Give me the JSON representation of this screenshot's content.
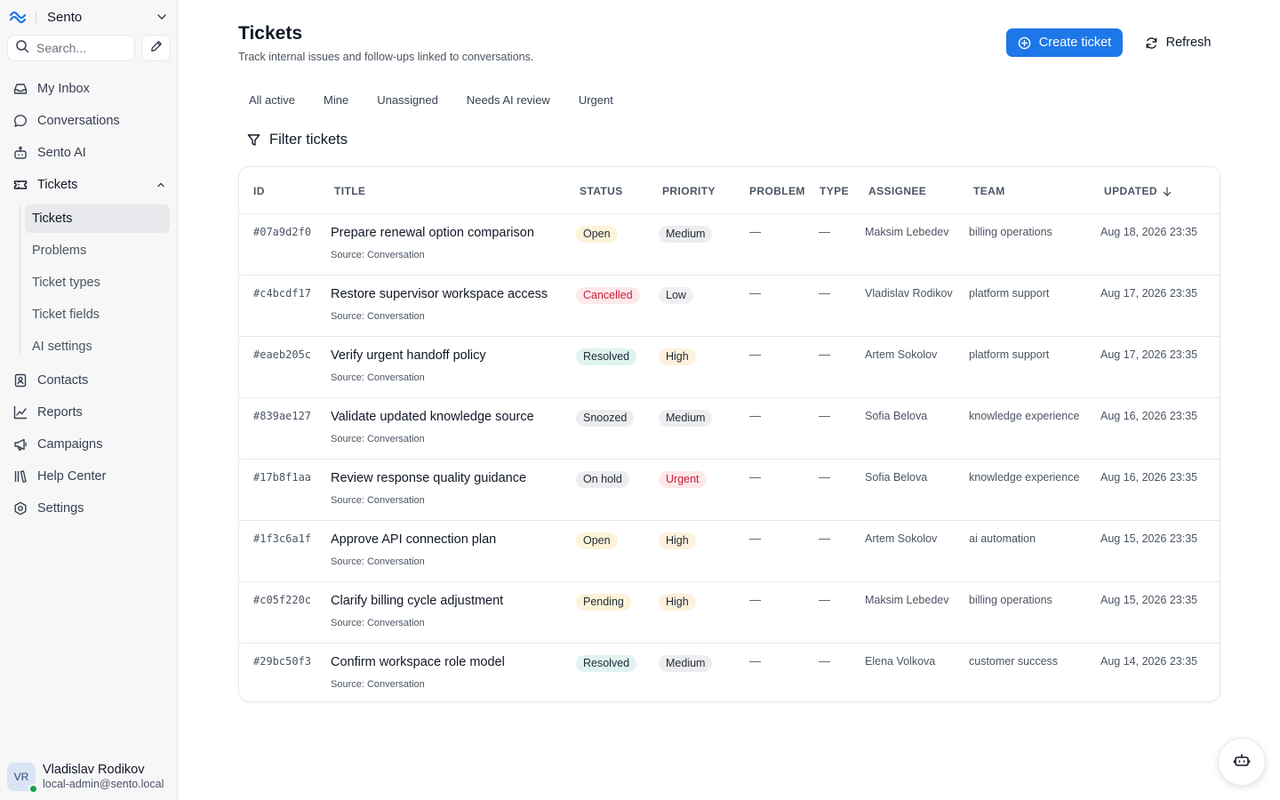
{
  "workspace": {
    "name": "Sento"
  },
  "search": {
    "placeholder": "Search..."
  },
  "nav": {
    "inbox": "My Inbox",
    "conversations": "Conversations",
    "ai": "Sento AI",
    "tickets": "Tickets",
    "contacts": "Contacts",
    "reports": "Reports",
    "campaigns": "Campaigns",
    "help_center": "Help Center",
    "settings": "Settings"
  },
  "subnav": [
    "Tickets",
    "Problems",
    "Ticket types",
    "Ticket fields",
    "AI settings"
  ],
  "user": {
    "initials": "VR",
    "name": "Vladislav Rodikov",
    "email": "local-admin@sento.local"
  },
  "header": {
    "title": "Tickets",
    "subtitle": "Track internal issues and follow-ups linked to conversations.",
    "create_label": "Create ticket",
    "refresh_label": "Refresh"
  },
  "tabs": [
    "All active",
    "Mine",
    "Unassigned",
    "Needs AI review",
    "Urgent"
  ],
  "filter_label": "Filter tickets",
  "colors": {
    "accent": "#1d77e8",
    "status": {
      "Open": {
        "bg": "#fdf3d9",
        "fg": "#1f2937"
      },
      "Cancelled": {
        "bg": "#fde8ea",
        "fg": "#c81e3a"
      },
      "Resolved": {
        "bg": "#dff3ef",
        "fg": "#1f2937"
      },
      "Snoozed": {
        "bg": "#ededef",
        "fg": "#1f2937"
      },
      "On hold": {
        "bg": "#ededef",
        "fg": "#1f2937"
      },
      "Pending": {
        "bg": "#fdf3d9",
        "fg": "#1f2937"
      }
    },
    "priority": {
      "Medium": {
        "bg": "#ededef",
        "fg": "#1f2937"
      },
      "Low": {
        "bg": "#f1f1f3",
        "fg": "#1f2937"
      },
      "High": {
        "bg": "#fdf1dc",
        "fg": "#1f2937"
      },
      "Urgent": {
        "bg": "#fde8ea",
        "fg": "#c81e3a"
      }
    }
  },
  "table": {
    "columns": {
      "id": "ID",
      "title": "TITLE",
      "status": "STATUS",
      "priority": "PRIORITY",
      "problem": "PROBLEM",
      "type": "TYPE",
      "assignee": "ASSIGNEE",
      "team": "TEAM",
      "updated": "UPDATED"
    },
    "rows": [
      {
        "id": "#07a9d2f0",
        "title": "Prepare renewal option comparison",
        "source": "Source: Conversation",
        "status": "Open",
        "priority": "Medium",
        "problem": "—",
        "type": "—",
        "assignee": "Maksim Lebedev",
        "team": "billing operations",
        "updated": "Aug 18, 2026 23:35"
      },
      {
        "id": "#c4bcdf17",
        "title": "Restore supervisor workspace access",
        "source": "Source: Conversation",
        "status": "Cancelled",
        "priority": "Low",
        "problem": "—",
        "type": "—",
        "assignee": "Vladislav Rodikov",
        "team": "platform support",
        "updated": "Aug 17, 2026 23:35"
      },
      {
        "id": "#eaeb205c",
        "title": "Verify urgent handoff policy",
        "source": "Source: Conversation",
        "status": "Resolved",
        "priority": "High",
        "problem": "—",
        "type": "—",
        "assignee": "Artem Sokolov",
        "team": "platform support",
        "updated": "Aug 17, 2026 23:35"
      },
      {
        "id": "#839ae127",
        "title": "Validate updated knowledge source",
        "source": "Source: Conversation",
        "status": "Snoozed",
        "priority": "Medium",
        "problem": "—",
        "type": "—",
        "assignee": "Sofia Belova",
        "team": "knowledge experience",
        "updated": "Aug 16, 2026 23:35"
      },
      {
        "id": "#17b8f1aa",
        "title": "Review response quality guidance",
        "source": "Source: Conversation",
        "status": "On hold",
        "priority": "Urgent",
        "problem": "—",
        "type": "—",
        "assignee": "Sofia Belova",
        "team": "knowledge experience",
        "updated": "Aug 16, 2026 23:35"
      },
      {
        "id": "#1f3c6a1f",
        "title": "Approve API connection plan",
        "source": "Source: Conversation",
        "status": "Open",
        "priority": "High",
        "problem": "—",
        "type": "—",
        "assignee": "Artem Sokolov",
        "team": "ai automation",
        "updated": "Aug 15, 2026 23:35"
      },
      {
        "id": "#c05f220c",
        "title": "Clarify billing cycle adjustment",
        "source": "Source: Conversation",
        "status": "Pending",
        "priority": "High",
        "problem": "—",
        "type": "—",
        "assignee": "Maksim Lebedev",
        "team": "billing operations",
        "updated": "Aug 15, 2026 23:35"
      },
      {
        "id": "#29bc50f3",
        "title": "Confirm workspace role model",
        "source": "Source: Conversation",
        "status": "Resolved",
        "priority": "Medium",
        "problem": "—",
        "type": "—",
        "assignee": "Elena Volkova",
        "team": "customer success",
        "updated": "Aug 14, 2026 23:35"
      }
    ]
  }
}
